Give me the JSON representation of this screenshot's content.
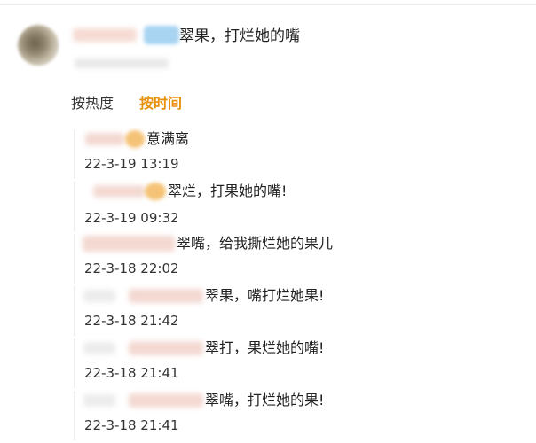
{
  "post": {
    "text": "翠果，打烂她的嘴"
  },
  "sort_tabs": [
    {
      "label": "按热度",
      "active": false
    },
    {
      "label": "按时间",
      "active": true
    }
  ],
  "comments": [
    {
      "text": "意满离",
      "time": "22-3-19 13:19"
    },
    {
      "text": "翠烂，打果她的嘴!",
      "time": "22-3-19 09:32"
    },
    {
      "text": "翠嘴，给我撕烂她的果儿",
      "time": "22-3-18 22:02"
    },
    {
      "text": "翠果，嘴打烂她果!",
      "time": "22-3-18 21:42"
    },
    {
      "text": "翠打，果烂她的嘴!",
      "time": "22-3-18 21:41"
    },
    {
      "text": "翠嘴，打烂她的果!",
      "time": "22-3-18 21:41"
    }
  ],
  "colors": {
    "active_tab": "#e8900c",
    "text": "#222222",
    "time": "#333333"
  }
}
